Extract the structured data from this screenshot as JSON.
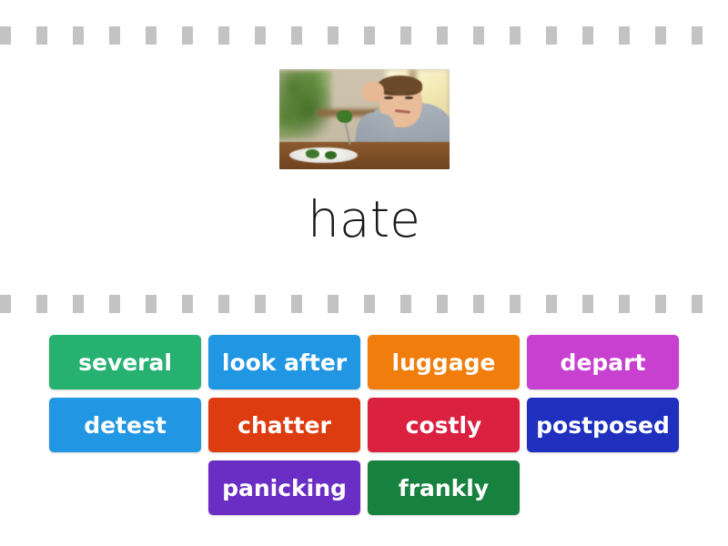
{
  "activity": {
    "type": "match-up-word-game",
    "background_color": "#ffffff"
  },
  "separators": {
    "dash_color": "#c3c3c3",
    "dash_count": 20,
    "rows": [
      "top",
      "middle"
    ]
  },
  "prompt": {
    "image": {
      "name": "boy-disgusted-by-broccoli-photo",
      "alt": "A boy sitting at a table resting his head on his hand, grimacing at a plate of broccoli"
    },
    "word": "hate"
  },
  "tiles": {
    "rows": [
      [
        {
          "label": "several",
          "color": "#26b171"
        },
        {
          "label": "look after",
          "color": "#2196e3"
        },
        {
          "label": "luggage",
          "color": "#f07d0c"
        },
        {
          "label": "depart",
          "color": "#c740d0"
        }
      ],
      [
        {
          "label": "detest",
          "color": "#2196e3"
        },
        {
          "label": "chatter",
          "color": "#dd3c10"
        },
        {
          "label": "costly",
          "color": "#da2140"
        },
        {
          "label": "postposed",
          "color": "#1f2fbe"
        }
      ],
      [
        {
          "label": "panicking",
          "color": "#6b2ec4"
        },
        {
          "label": "frankly",
          "color": "#17813f"
        }
      ]
    ]
  }
}
